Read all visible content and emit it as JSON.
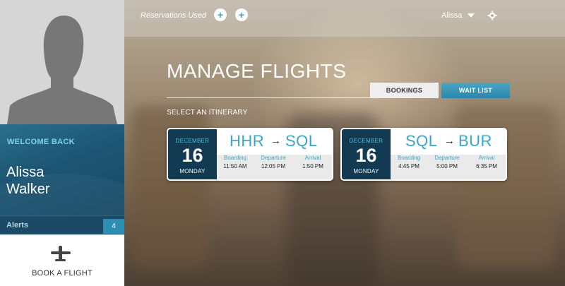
{
  "sidebar": {
    "welcome_label": "WELCOME BACK",
    "first_name": "Alissa",
    "last_name": "Walker",
    "alerts_label": "Alerts",
    "alerts_count": "4",
    "book_flight_label": "BOOK A FLIGHT",
    "book_flight_icon": "airplane-icon",
    "avatar_icon": "user-silhouette-icon"
  },
  "topbar": {
    "reservations_label": "Reservations Used",
    "reservation_icons": [
      "plus-icon",
      "plus-icon"
    ],
    "plus_symbol": "+",
    "user_name": "Alissa",
    "user_caret_icon": "caret-down-icon",
    "settings_icon": "gear-icon"
  },
  "main": {
    "title": "MANAGE FLIGHTS",
    "tabs": [
      {
        "label": "BOOKINGS"
      },
      {
        "label": "WAIT LIST"
      }
    ],
    "select_label": "SELECT AN ITINERARY",
    "arrow_symbol": "→",
    "flights": [
      {
        "month": "DECEMBER",
        "day": "16",
        "weekday": "MONDAY",
        "from": "HHR",
        "to": "SQL",
        "boarding_label": "Boarding",
        "boarding_time": "11:50 AM",
        "departure_label": "Departure",
        "departure_time": "12:05 PM",
        "arrival_label": "Arrival",
        "arrival_time": "1:50 PM"
      },
      {
        "month": "DECEMBER",
        "day": "16",
        "weekday": "MONDAY",
        "from": "SQL",
        "to": "BUR",
        "boarding_label": "Boarding",
        "boarding_time": "4:45 PM",
        "departure_label": "Departure",
        "departure_time": "5:00 PM",
        "arrival_label": "Arrival",
        "arrival_time": "6:35 PM"
      }
    ]
  },
  "colors": {
    "accent": "#3aa5c8",
    "sidebar_panel": "#1c5573",
    "date_block": "#123a52",
    "waitlist_tab": "#2c86a8"
  }
}
